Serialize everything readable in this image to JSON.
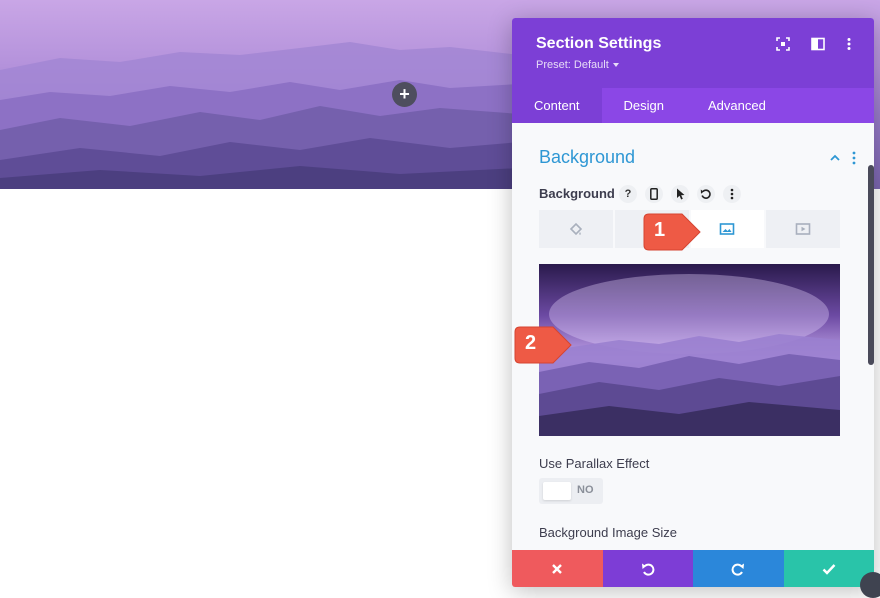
{
  "canvas": {
    "add_button_label": "+"
  },
  "modal": {
    "title": "Section Settings",
    "preset": "Preset: Default",
    "header_icons": [
      "screenshot-icon",
      "split-view-icon",
      "more-options-icon"
    ],
    "tabs": [
      {
        "label": "Content",
        "active": true
      },
      {
        "label": "Design",
        "active": false
      },
      {
        "label": "Advanced",
        "active": false
      }
    ],
    "section": {
      "title": "Background"
    },
    "background": {
      "label": "Background",
      "help_label": "?",
      "option_icons": [
        "help-icon",
        "mobile-icon",
        "hover-cursor-icon",
        "reset-icon",
        "more-icon"
      ],
      "type_tabs": [
        {
          "icon": "color-bucket-icon",
          "active": false
        },
        {
          "icon": "gradient-icon",
          "active": false
        },
        {
          "icon": "image-icon",
          "active": true
        },
        {
          "icon": "video-icon",
          "active": false
        }
      ]
    },
    "fields": {
      "parallax_label": "Use Parallax Effect",
      "parallax_value": "NO",
      "image_size_label": "Background Image Size"
    },
    "footer": [
      {
        "action": "cancel",
        "color": "#ef5a5d"
      },
      {
        "action": "undo",
        "color": "#7d3dd6"
      },
      {
        "action": "redo",
        "color": "#2b87da"
      },
      {
        "action": "save",
        "color": "#29c4a9"
      }
    ]
  },
  "callouts": [
    {
      "label": "1"
    },
    {
      "label": "2"
    }
  ],
  "colors": {
    "header_purple": "#7c3fd6",
    "tabs_purple": "#8b47e6",
    "section_title_blue": "#2e97d4",
    "callout_red": "#ee5a45"
  }
}
